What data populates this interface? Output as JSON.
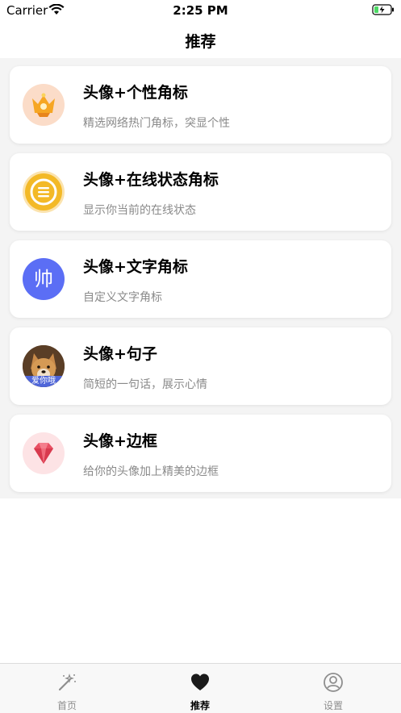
{
  "status_bar": {
    "carrier": "Carrier",
    "time": "2:25 PM"
  },
  "nav": {
    "title": "推荐"
  },
  "cards": [
    {
      "title": "头像+个性角标",
      "desc": "精选网络热门角标，突显个性",
      "icon": "crown-icon"
    },
    {
      "title": "头像+在线状态角标",
      "desc": "显示你当前的在线状态",
      "icon": "status-icon"
    },
    {
      "title": "头像+文字角标",
      "desc": "自定义文字角标",
      "icon": "text-badge-icon",
      "icon_text": "帅"
    },
    {
      "title": "头像+句子",
      "desc": "简短的一句话，展示心情",
      "icon": "dog-avatar-icon",
      "badge_text": "爱你哦"
    },
    {
      "title": "头像+边框",
      "desc": "给你的头像加上精美的边框",
      "icon": "gem-icon"
    }
  ],
  "tabs": [
    {
      "label": "首页",
      "icon": "magic-wand-icon",
      "active": false
    },
    {
      "label": "推荐",
      "icon": "heart-icon",
      "active": true
    },
    {
      "label": "设置",
      "icon": "user-circle-icon",
      "active": false
    }
  ],
  "colors": {
    "accent_blue": "#5b6ef5",
    "status_yellow": "#f3b927",
    "gem_red": "#e85063",
    "battery_green": "#4cd964"
  }
}
